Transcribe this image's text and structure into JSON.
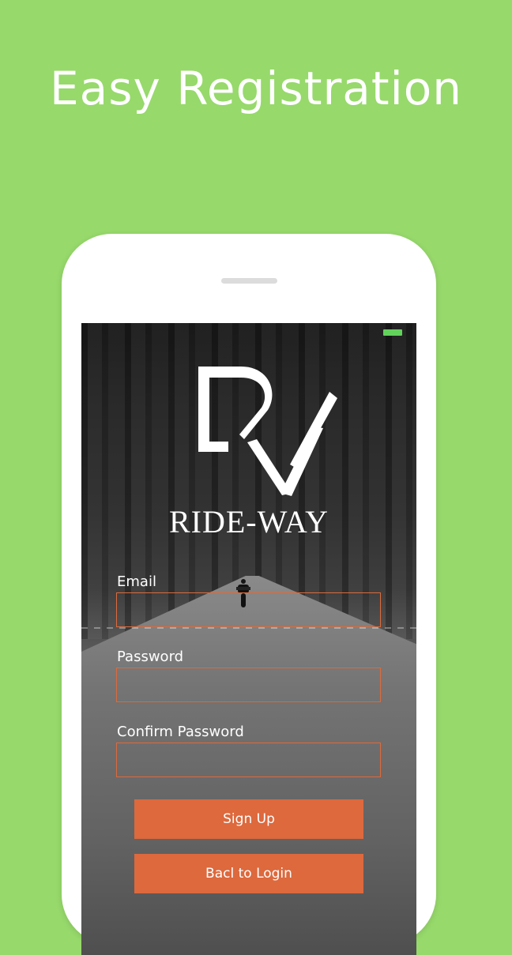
{
  "headline": "Easy Registration",
  "app": {
    "brand_name": "RIDE-WAY",
    "logo_icon": "rw-monogram-logo"
  },
  "form": {
    "email_label": "Email",
    "email_value": "",
    "password_label": "Password",
    "password_value": "",
    "confirm_password_label": "Confirm Password",
    "confirm_password_value": ""
  },
  "buttons": {
    "sign_up": "Sign Up",
    "back_to_login": "Bacl to Login"
  },
  "colors": {
    "background": "#97d96b",
    "accent": "#dd693d",
    "battery": "#62d15c"
  }
}
